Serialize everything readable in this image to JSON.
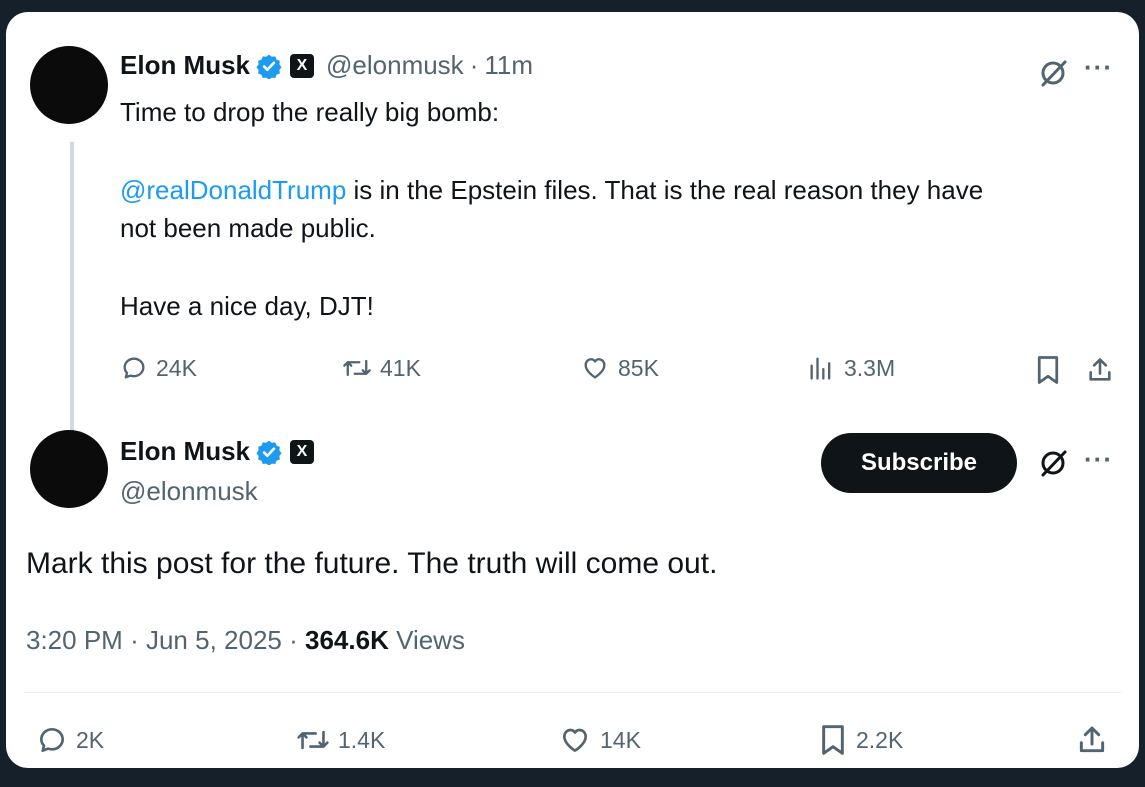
{
  "tweet1": {
    "author_name": "Elon Musk",
    "badge_letter": "X",
    "handle": "@elonmusk",
    "time_sep": "·",
    "time": "11m",
    "line1": "Time to drop the really big bomb:",
    "mention": "@realDonaldTrump",
    "line2": " is in the Epstein files. That is the real reason they have",
    "line3": "not been made public.",
    "line4": "Have a nice day, DJT!",
    "replies": "24K",
    "reposts": "41K",
    "likes": "85K",
    "views": "3.3M"
  },
  "tweet2": {
    "author_name": "Elon Musk",
    "badge_letter": "X",
    "handle": "@elonmusk",
    "subscribe_label": "Subscribe",
    "body": "Mark this post for the future. The truth will come out.",
    "time": "3:20 PM",
    "date": "Jun 5, 2025",
    "views_count": "364.6K",
    "views_label": "Views",
    "sep": "·",
    "replies": "2K",
    "reposts": "1.4K",
    "likes": "14K",
    "bookmarks": "2.2K"
  },
  "more_label": "···",
  "colors": {
    "verified": "#1d9bf0",
    "link": "#1d9bf0",
    "secondary_text": "#536471",
    "page_bg": "#15202b"
  },
  "icons": [
    "verified-icon",
    "x-badge-icon",
    "grok-icon",
    "more-icon",
    "reply-icon",
    "repost-icon",
    "like-icon",
    "views-icon",
    "bookmark-icon",
    "share-icon"
  ]
}
